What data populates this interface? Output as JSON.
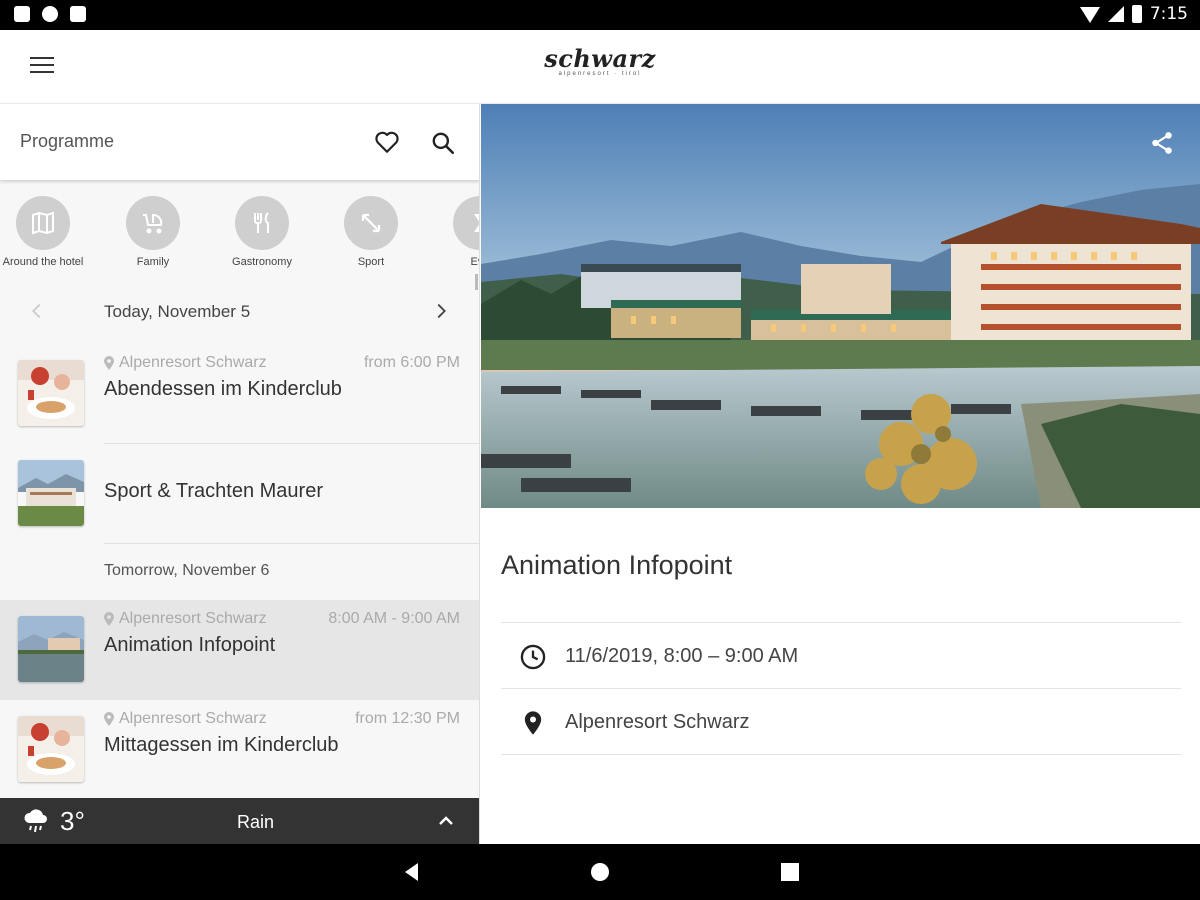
{
  "status_bar": {
    "time": "7:15"
  },
  "app_bar": {
    "brand": "schwarz",
    "brand_sub": "alpenresort · tirol"
  },
  "search_bar": {
    "title": "Programme"
  },
  "categories": [
    {
      "label": "Around the hotel",
      "icon": "map-icon"
    },
    {
      "label": "Family",
      "icon": "stroller-icon"
    },
    {
      "label": "Gastronomy",
      "icon": "cutlery-icon"
    },
    {
      "label": "Sport",
      "icon": "expand-arrows-icon"
    },
    {
      "label": "Eve",
      "icon": "hourglass-icon"
    }
  ],
  "day_nav": {
    "date": "Today, November 5"
  },
  "events_today": [
    {
      "location": "Alpenresort Schwarz",
      "time": "from 6:00 PM",
      "name": "Abendessen im Kinderclub"
    },
    {
      "location": "",
      "time": "",
      "name": "Sport & Trachten Maurer"
    }
  ],
  "section_tomorrow": "Tomorrow, November 6",
  "events_tomorrow": [
    {
      "location": "Alpenresort Schwarz",
      "time": "8:00 AM - 9:00 AM",
      "name": "Animation Infopoint"
    },
    {
      "location": "Alpenresort Schwarz",
      "time": "from 12:30 PM",
      "name": "Mittagessen im Kinderclub"
    }
  ],
  "weather": {
    "temperature": "3°",
    "condition": "Rain"
  },
  "detail": {
    "title": "Animation Infopoint",
    "datetime": "11/6/2019, 8:00 – 9:00 AM",
    "location": "Alpenresort Schwarz"
  },
  "colors": {
    "accent": "#333333",
    "selected_row": "#e6e6e6",
    "weather_bar": "#333333"
  }
}
